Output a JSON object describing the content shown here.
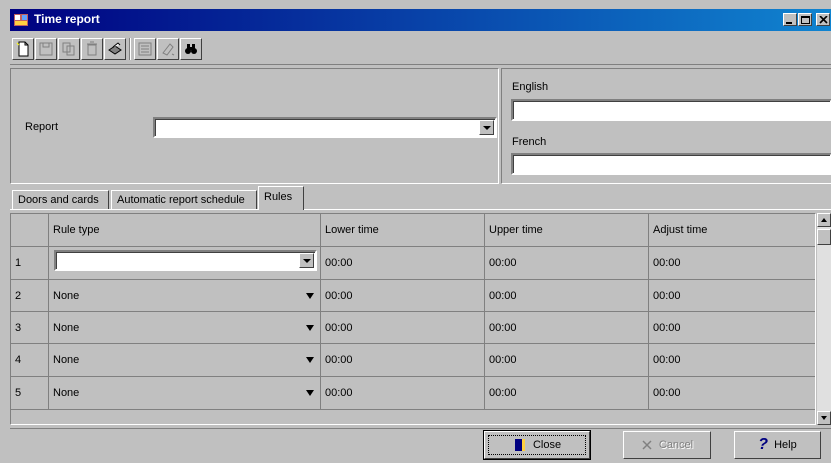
{
  "window": {
    "title": "Time report"
  },
  "header": {
    "report_label": "Report",
    "report_value": "",
    "english_label": "English",
    "english_value": "",
    "french_label": "French",
    "french_value": ""
  },
  "tabs": [
    {
      "label": "Doors and cards",
      "active": false
    },
    {
      "label": "Automatic report schedule",
      "active": false
    },
    {
      "label": "Rules",
      "active": true
    }
  ],
  "grid": {
    "columns": [
      "Rule type",
      "Lower time",
      "Upper time",
      "Adjust time"
    ],
    "rows": [
      {
        "num": "1",
        "rule_type": "",
        "lower": "00:00",
        "upper": "00:00",
        "adjust": "00:00"
      },
      {
        "num": "2",
        "rule_type": "None",
        "lower": "00:00",
        "upper": "00:00",
        "adjust": "00:00"
      },
      {
        "num": "3",
        "rule_type": "None",
        "lower": "00:00",
        "upper": "00:00",
        "adjust": "00:00"
      },
      {
        "num": "4",
        "rule_type": "None",
        "lower": "00:00",
        "upper": "00:00",
        "adjust": "00:00"
      },
      {
        "num": "5",
        "rule_type": "None",
        "lower": "00:00",
        "upper": "00:00",
        "adjust": "00:00"
      }
    ]
  },
  "buttons": {
    "close": "Close",
    "cancel": "Cancel",
    "help": "Help"
  },
  "toolbar": {
    "icons": [
      "new-icon",
      "save-icon",
      "copy-icon",
      "delete-icon",
      "print-icon",
      "list-icon",
      "eraser-icon",
      "find-icon"
    ]
  },
  "colors": {
    "titlebar": "#000080",
    "face": "#c0c0c0"
  }
}
